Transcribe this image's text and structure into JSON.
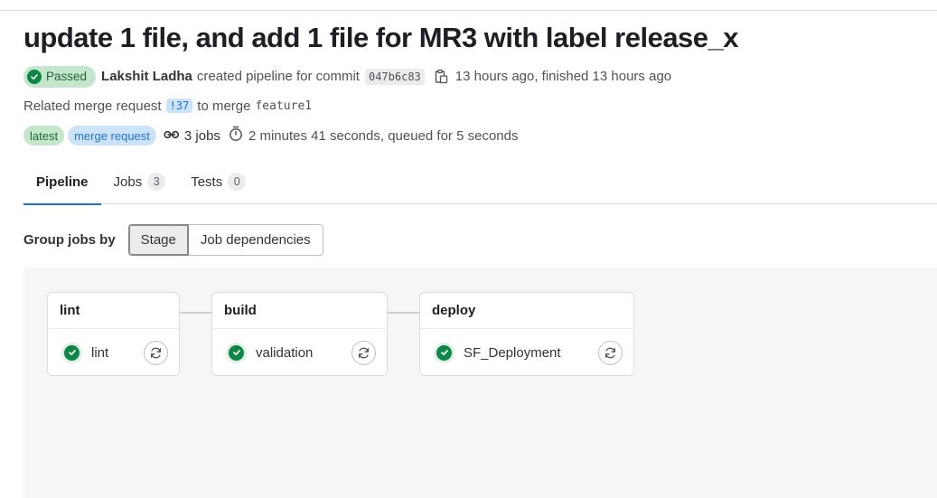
{
  "header": {
    "title": "update 1 file, and add 1 file for MR3 with label release_x",
    "status": "Passed",
    "author": "Lakshit Ladha",
    "created_text": "created pipeline for commit",
    "commit_sha": "047b6c83",
    "copy_icon": "copy-icon",
    "time_text": "13 hours ago, finished 13 hours ago",
    "related_text": "Related merge request",
    "mr_ref": "!37",
    "to_merge_text": "to merge",
    "branch": "feature1",
    "badges": [
      "latest",
      "merge request"
    ],
    "jobs_icon": "pipeline-jobs-icon",
    "jobs_text": "3 jobs",
    "timer_icon": "timer-icon",
    "duration_text": "2 minutes 41 seconds, queued for 5 seconds"
  },
  "tabs": [
    {
      "label": "Pipeline",
      "count": null
    },
    {
      "label": "Jobs",
      "count": "3"
    },
    {
      "label": "Tests",
      "count": "0"
    }
  ],
  "group_by": {
    "label": "Group jobs by",
    "options": [
      "Stage",
      "Job dependencies"
    ],
    "selected": "Stage"
  },
  "stages": [
    {
      "name": "lint",
      "jobs": [
        {
          "name": "lint",
          "status": "passed",
          "action_icon": "retry-icon"
        }
      ]
    },
    {
      "name": "build",
      "jobs": [
        {
          "name": "validation",
          "status": "passed",
          "action_icon": "retry-icon"
        }
      ]
    },
    {
      "name": "deploy",
      "jobs": [
        {
          "name": "SF_Deployment",
          "status": "passed",
          "action_icon": "retry-icon"
        }
      ]
    }
  ],
  "colors": {
    "success": "#108548",
    "success_bg": "#c3e6cd",
    "link": "#1f75cb",
    "link_bg": "#cbe2f9",
    "graph_bg": "#f6f6f7"
  }
}
